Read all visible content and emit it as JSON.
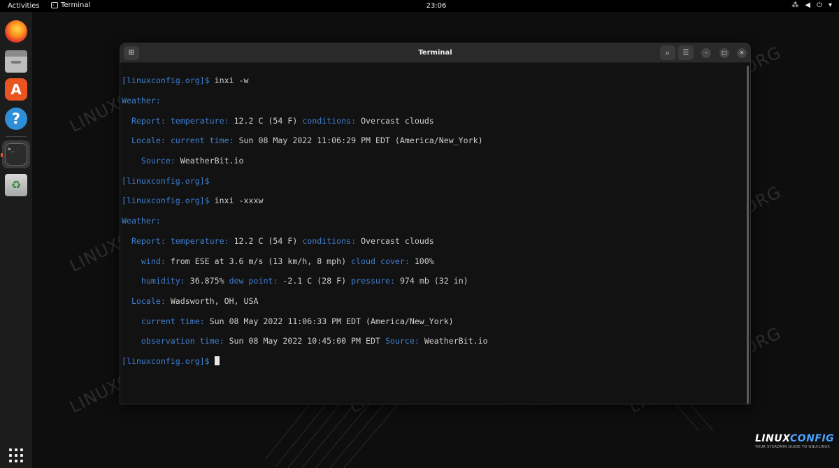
{
  "topbar": {
    "activities": "Activities",
    "app_name": "Terminal",
    "clock": "23:06"
  },
  "window": {
    "title": "Terminal"
  },
  "terminal": {
    "prompt": "[linuxconfig.org]$",
    "cmd1": "inxi -w",
    "cmd2": "inxi -xxxw",
    "weather_label": "Weather:",
    "report_label": "Report:",
    "temperature_label": "temperature:",
    "temperature_value": "12.2 C (54 F)",
    "conditions_label": "conditions:",
    "conditions_value": "Overcast clouds",
    "locale_label": "Locale:",
    "current_time_label": "current time:",
    "current_time_1": "Sun 08 May 2022 11:06:29 PM EDT (America/New_York)",
    "source_label": "Source:",
    "source_value": "WeatherBit.io",
    "wind_label": "wind:",
    "wind_value": "from ESE at 3.6 m/s (13 km/h, 8 mph)",
    "cloud_cover_label": "cloud cover:",
    "cloud_cover_value": "100%",
    "humidity_label": "humidity:",
    "humidity_value": "36.875%",
    "dew_point_label": "dew point:",
    "dew_point_value": "-2.1 C (28 F)",
    "pressure_label": "pressure:",
    "pressure_value": "974 mb (32 in)",
    "locale_value": "Wadsworth, OH, USA",
    "current_time_2": "Sun 08 May 2022 11:06:33 PM EDT (America/New_York)",
    "observation_time_label": "observation time:",
    "observation_time_value": "Sun 08 May 2022 10:45:00 PM EDT"
  },
  "dock": {
    "icons": [
      "firefox-icon",
      "files-icon",
      "app-center-icon",
      "help-icon",
      "terminal-icon",
      "trash-icon",
      "show-apps-icon"
    ]
  },
  "watermark": {
    "text": "LINUXCONFIG.ORG",
    "brand_linux": "LINUX",
    "brand_config": "CONFIG",
    "brand_tagline": "YOUR SYSADMIN GUIDE TO GNU/LINUX"
  },
  "colors": {
    "accent_orange": "#e95420",
    "terminal_key": "#3f7fd0",
    "terminal_text": "#d0d0d0"
  }
}
